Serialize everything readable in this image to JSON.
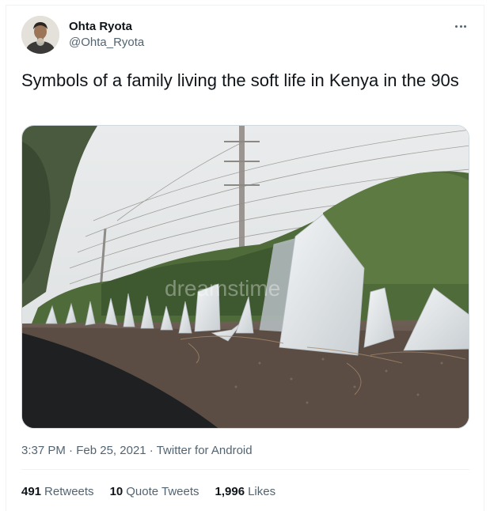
{
  "author": {
    "display_name": "Ohta Ryota",
    "handle": "@Ohta_Ryota"
  },
  "tweet": {
    "text": "Symbols of a family living the soft life in Kenya in the 90s",
    "time": "3:37 PM",
    "separator": "·",
    "date": "Feb 25, 2021",
    "source": "Twitter for Android"
  },
  "media": {
    "watermark": "dreamstime"
  },
  "stats": {
    "retweets": {
      "count": "491",
      "label": "Retweets"
    },
    "quote_tweets": {
      "count": "10",
      "label": "Quote Tweets"
    },
    "likes": {
      "count": "1,996",
      "label": "Likes"
    }
  },
  "icons": {
    "more": "more-horizontal-icon"
  },
  "colors": {
    "text_primary": "#0f1419",
    "text_secondary": "#536471",
    "divider": "#eff3f4"
  }
}
